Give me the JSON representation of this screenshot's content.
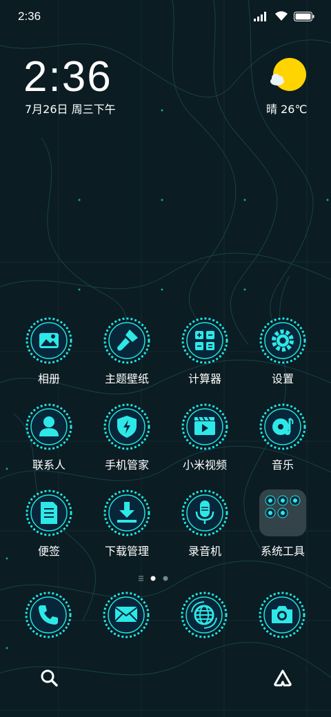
{
  "status_bar": {
    "time": "2:36",
    "icons": [
      "signal-icon",
      "wifi-icon",
      "battery-icon"
    ]
  },
  "clock_widget": {
    "time": "2:36",
    "date": "7月26日 周三下午"
  },
  "weather_widget": {
    "text": "晴 26℃",
    "icon": "sunny-icon"
  },
  "apps": [
    {
      "label": "相册",
      "icon": "gallery-icon"
    },
    {
      "label": "主题壁纸",
      "icon": "theme-brush-icon"
    },
    {
      "label": "计算器",
      "icon": "calculator-icon"
    },
    {
      "label": "设置",
      "icon": "gear-icon"
    },
    {
      "label": "联系人",
      "icon": "contact-person-icon"
    },
    {
      "label": "手机管家",
      "icon": "security-shield-icon"
    },
    {
      "label": "小米视频",
      "icon": "video-clapper-icon"
    },
    {
      "label": "音乐",
      "icon": "music-icon"
    },
    {
      "label": "便签",
      "icon": "notes-icon"
    },
    {
      "label": "下载管理",
      "icon": "download-icon"
    },
    {
      "label": "录音机",
      "icon": "microphone-icon"
    },
    {
      "label": "系统工具",
      "icon": "folder-icon"
    }
  ],
  "dock": [
    {
      "icon": "phone-icon"
    },
    {
      "icon": "messages-icon"
    },
    {
      "icon": "browser-globe-icon"
    },
    {
      "icon": "camera-icon"
    }
  ],
  "page_indicator": {
    "pages": 2,
    "current": 1
  },
  "bottom_bar": {
    "left": "search-icon",
    "right": "app-vault-icon"
  },
  "colors": {
    "background": "#0b1c22",
    "accent": "#1ee6e6",
    "icon_core": "#08263a"
  }
}
